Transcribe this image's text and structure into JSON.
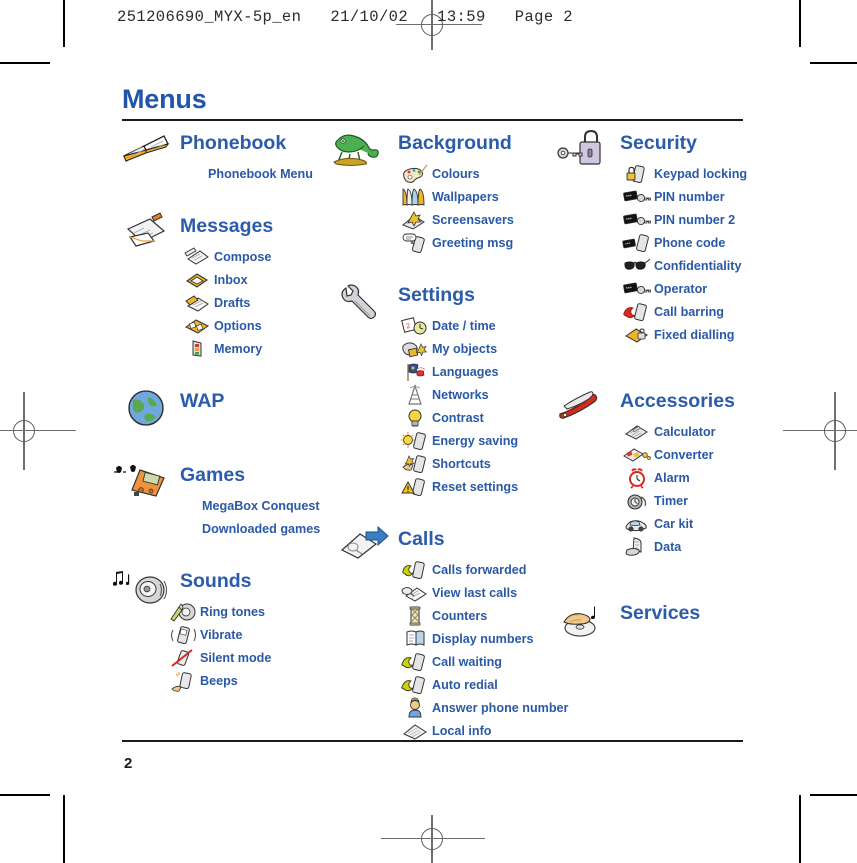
{
  "print_marks": {
    "slug": "251206690_MYX-5p_en   21/10/02   13:59   Page 2"
  },
  "page": {
    "title": "Menus",
    "folio": "2",
    "title_color": "#2255aa",
    "heading_color": "#2b5bab",
    "item_color": "#2a59a6"
  },
  "columns": [
    {
      "id": "column-left",
      "sections": [
        {
          "name": "phonebook",
          "title": "Phonebook",
          "icon": "open-book-icon",
          "items": [
            {
              "label": "Phonebook Menu",
              "icon": null
            }
          ]
        },
        {
          "name": "messages",
          "title": "Messages",
          "icon": "envelope-pencil-icon",
          "items": [
            {
              "label": "Compose",
              "icon": "compose-icon"
            },
            {
              "label": "Inbox",
              "icon": "inbox-tray-icon"
            },
            {
              "label": "Drafts",
              "icon": "drafts-icon"
            },
            {
              "label": "Options",
              "icon": "options-icon"
            },
            {
              "label": "Memory",
              "icon": "memory-icon"
            }
          ]
        },
        {
          "name": "wap",
          "title": "WAP",
          "icon": "globe-icon",
          "items": []
        },
        {
          "name": "games",
          "title": "Games",
          "icon": "handheld-console-icon",
          "items": [
            {
              "label": "MegaBox Conquest",
              "icon": null
            },
            {
              "label": "Downloaded games",
              "icon": null
            }
          ]
        },
        {
          "name": "sounds",
          "title": "Sounds",
          "icon": "speaker-notes-icon",
          "items": [
            {
              "label": "Ring tones",
              "icon": "ring-tones-icon"
            },
            {
              "label": "Vibrate",
              "icon": "vibrate-icon"
            },
            {
              "label": "Silent mode",
              "icon": "silent-mode-icon"
            },
            {
              "label": "Beeps",
              "icon": "beeps-icon"
            }
          ]
        }
      ]
    },
    {
      "id": "column-middle",
      "sections": [
        {
          "name": "background",
          "title": "Background",
          "icon": "chameleon-icon",
          "items": [
            {
              "label": "Colours",
              "icon": "palette-icon"
            },
            {
              "label": "Wallpapers",
              "icon": "wallpapers-icon"
            },
            {
              "label": "Screensavers",
              "icon": "screensavers-icon"
            },
            {
              "label": "Greeting msg",
              "icon": "greeting-msg-icon"
            }
          ]
        },
        {
          "name": "settings",
          "title": "Settings",
          "icon": "wrench-icon",
          "items": [
            {
              "label": "Date / time",
              "icon": "calendar-clock-icon"
            },
            {
              "label": "My objects",
              "icon": "my-objects-icon"
            },
            {
              "label": "Languages",
              "icon": "flags-icon"
            },
            {
              "label": "Networks",
              "icon": "antenna-icon"
            },
            {
              "label": "Contrast",
              "icon": "lightbulb-icon"
            },
            {
              "label": "Energy saving",
              "icon": "sun-phone-icon"
            },
            {
              "label": "Shortcuts",
              "icon": "shortcuts-icon"
            },
            {
              "label": "Reset settings",
              "icon": "reset-warning-icon"
            }
          ]
        },
        {
          "name": "calls",
          "title": "Calls",
          "icon": "call-arrow-icon",
          "items": [
            {
              "label": "Calls forwarded",
              "icon": "calls-forwarded-icon"
            },
            {
              "label": "View last calls",
              "icon": "view-last-calls-icon"
            },
            {
              "label": "Counters",
              "icon": "counters-icon"
            },
            {
              "label": "Display numbers",
              "icon": "display-numbers-icon"
            },
            {
              "label": "Call waiting",
              "icon": "call-waiting-icon"
            },
            {
              "label": "Auto redial",
              "icon": "auto-redial-icon"
            },
            {
              "label": "Answer phone number",
              "icon": "answer-phone-icon"
            },
            {
              "label": "Local info",
              "icon": "local-info-icon"
            }
          ]
        }
      ]
    },
    {
      "id": "column-right",
      "sections": [
        {
          "name": "security",
          "title": "Security",
          "icon": "padlock-key-icon",
          "items": [
            {
              "label": "Keypad locking",
              "icon": "keypad-locking-icon"
            },
            {
              "label": "PIN number",
              "icon": "pin-number-icon"
            },
            {
              "label": "PIN number 2",
              "icon": "pin-number-2-icon"
            },
            {
              "label": "Phone code",
              "icon": "phone-code-icon"
            },
            {
              "label": "Confidentiality",
              "icon": "sunglasses-icon"
            },
            {
              "label": "Operator",
              "icon": "operator-icon"
            },
            {
              "label": "Call barring",
              "icon": "call-barring-icon"
            },
            {
              "label": "Fixed dialling",
              "icon": "fixed-dialling-icon"
            }
          ]
        },
        {
          "name": "accessories",
          "title": "Accessories",
          "icon": "swiss-knife-icon",
          "items": [
            {
              "label": "Calculator",
              "icon": "calculator-icon"
            },
            {
              "label": "Converter",
              "icon": "converter-icon"
            },
            {
              "label": "Alarm",
              "icon": "alarm-clock-icon"
            },
            {
              "label": "Timer",
              "icon": "timer-icon"
            },
            {
              "label": "Car kit",
              "icon": "car-kit-icon"
            },
            {
              "label": "Data",
              "icon": "data-icon"
            }
          ]
        },
        {
          "name": "services",
          "title": "Services",
          "icon": "hand-disc-icon",
          "items": []
        }
      ]
    }
  ]
}
